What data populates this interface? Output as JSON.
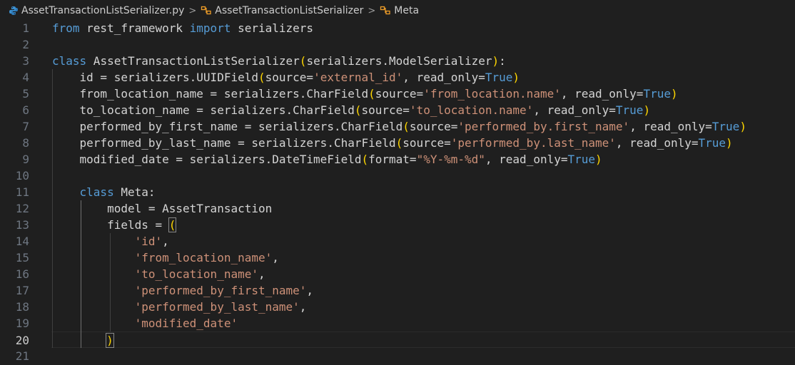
{
  "breadcrumb": {
    "file": "AssetTransactionListSerializer.py",
    "class": "AssetTransactionListSerializer",
    "meta": "Meta",
    "separator": ">"
  },
  "editor": {
    "active_line": 20,
    "lines": [
      {
        "n": "1",
        "tokens": [
          [
            "kw",
            "from"
          ],
          [
            "",
            " rest_framework "
          ],
          [
            "kw",
            "import"
          ],
          [
            "",
            " serializers"
          ]
        ]
      },
      {
        "n": "2",
        "tokens": []
      },
      {
        "n": "3",
        "tokens": [
          [
            "kw",
            "class"
          ],
          [
            "",
            " AssetTransactionListSerializer"
          ],
          [
            "par",
            "("
          ],
          [
            "",
            "serializers.ModelSerializer"
          ],
          [
            "par",
            ")"
          ],
          [
            "",
            ":"
          ]
        ]
      },
      {
        "n": "4",
        "tokens": [
          [
            "",
            "    id = serializers.UUIDField"
          ],
          [
            "par",
            "("
          ],
          [
            "",
            "source="
          ],
          [
            "str",
            "'external_id'"
          ],
          [
            "",
            ", read_only="
          ],
          [
            "kw",
            "True"
          ],
          [
            "par",
            ")"
          ]
        ]
      },
      {
        "n": "5",
        "tokens": [
          [
            "",
            "    from_location_name = serializers.CharField"
          ],
          [
            "par",
            "("
          ],
          [
            "",
            "source="
          ],
          [
            "str",
            "'from_location.name'"
          ],
          [
            "",
            ", read_only="
          ],
          [
            "kw",
            "True"
          ],
          [
            "par",
            ")"
          ]
        ]
      },
      {
        "n": "6",
        "tokens": [
          [
            "",
            "    to_location_name = serializers.CharField"
          ],
          [
            "par",
            "("
          ],
          [
            "",
            "source="
          ],
          [
            "str",
            "'to_location.name'"
          ],
          [
            "",
            ", read_only="
          ],
          [
            "kw",
            "True"
          ],
          [
            "par",
            ")"
          ]
        ]
      },
      {
        "n": "7",
        "tokens": [
          [
            "",
            "    performed_by_first_name = serializers.CharField"
          ],
          [
            "par",
            "("
          ],
          [
            "",
            "source="
          ],
          [
            "str",
            "'performed_by.first_name'"
          ],
          [
            "",
            ", read_only="
          ],
          [
            "kw",
            "True"
          ],
          [
            "par",
            ")"
          ]
        ]
      },
      {
        "n": "8",
        "tokens": [
          [
            "",
            "    performed_by_last_name = serializers.CharField"
          ],
          [
            "par",
            "("
          ],
          [
            "",
            "source="
          ],
          [
            "str",
            "'performed_by.last_name'"
          ],
          [
            "",
            ", read_only="
          ],
          [
            "kw",
            "True"
          ],
          [
            "par",
            ")"
          ]
        ]
      },
      {
        "n": "9",
        "tokens": [
          [
            "",
            "    modified_date = serializers.DateTimeField"
          ],
          [
            "par",
            "("
          ],
          [
            "",
            "format="
          ],
          [
            "str",
            "\"%Y-%m-%d\""
          ],
          [
            "",
            ", read_only="
          ],
          [
            "kw",
            "True"
          ],
          [
            "par",
            ")"
          ]
        ]
      },
      {
        "n": "10",
        "tokens": []
      },
      {
        "n": "11",
        "tokens": [
          [
            "",
            "    "
          ],
          [
            "kw",
            "class"
          ],
          [
            "",
            " Meta:"
          ]
        ]
      },
      {
        "n": "12",
        "tokens": [
          [
            "",
            "        model = AssetTransaction"
          ]
        ]
      },
      {
        "n": "13",
        "tokens": [
          [
            "",
            "        fields = "
          ],
          [
            "par brk-box",
            "("
          ]
        ]
      },
      {
        "n": "14",
        "tokens": [
          [
            "",
            "            "
          ],
          [
            "str",
            "'id'"
          ],
          [
            "",
            ","
          ]
        ]
      },
      {
        "n": "15",
        "tokens": [
          [
            "",
            "            "
          ],
          [
            "str",
            "'from_location_name'"
          ],
          [
            "",
            ","
          ]
        ]
      },
      {
        "n": "16",
        "tokens": [
          [
            "",
            "            "
          ],
          [
            "str",
            "'to_location_name'"
          ],
          [
            "",
            ","
          ]
        ]
      },
      {
        "n": "17",
        "tokens": [
          [
            "",
            "            "
          ],
          [
            "str",
            "'performed_by_first_name'"
          ],
          [
            "",
            ","
          ]
        ]
      },
      {
        "n": "18",
        "tokens": [
          [
            "",
            "            "
          ],
          [
            "str",
            "'performed_by_last_name'"
          ],
          [
            "",
            ","
          ]
        ]
      },
      {
        "n": "19",
        "tokens": [
          [
            "",
            "            "
          ],
          [
            "str",
            "'modified_date'"
          ]
        ]
      },
      {
        "n": "20",
        "tokens": [
          [
            "",
            "        "
          ],
          [
            "par brk-box",
            ")"
          ]
        ]
      },
      {
        "n": "21",
        "tokens": []
      }
    ]
  },
  "colors": {
    "background": "#1f1f1f",
    "keyword": "#569cd6",
    "string": "#ce9178",
    "bracket": "#ffd700",
    "text": "#d4d4d4",
    "line_number": "#6e7681"
  },
  "icons": {
    "file": "python-file-icon",
    "class": "symbol-class-icon",
    "meta": "symbol-class-icon"
  }
}
